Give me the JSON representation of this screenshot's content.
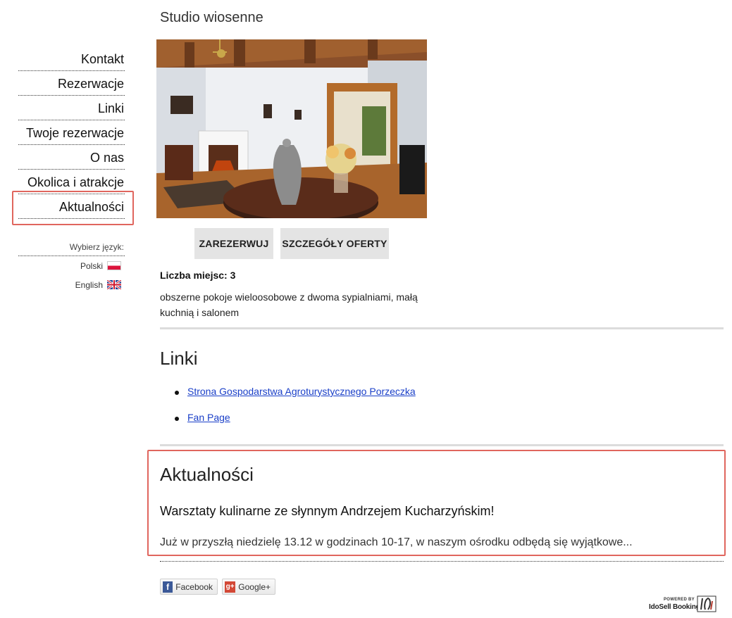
{
  "sidebar": {
    "items": [
      {
        "label": "Kontakt"
      },
      {
        "label": "Rezerwacje"
      },
      {
        "label": "Linki"
      },
      {
        "label": "Twoje rezerwacje"
      },
      {
        "label": "O nas"
      },
      {
        "label": "Okolica i atrakcje"
      },
      {
        "label": "Aktualności"
      }
    ],
    "language": {
      "label": "Wybierz język:",
      "options": [
        {
          "label": "Polski",
          "flag": "poland-flag-icon"
        },
        {
          "label": "English",
          "flag": "uk-flag-icon"
        }
      ]
    }
  },
  "room": {
    "title": "Studio wiosenne",
    "photo_icon": "room-interior-photo",
    "reserve_label": "ZAREZERWUJ",
    "details_label": "SZCZEGÓŁY OFERTY",
    "capacity_label": "Liczba miejsc:",
    "capacity_value": "3",
    "description": "obszerne pokoje wieloosobowe z dwoma sypialniami, małą kuchnią i salonem"
  },
  "links": {
    "title": "Linki",
    "items": [
      {
        "label": "Strona Gospodarstwa Agroturystycznego Porzeczka"
      },
      {
        "label": "Fan Page"
      }
    ]
  },
  "news": {
    "title": "Aktualności",
    "headline": "Warsztaty kulinarne ze słynnym Andrzejem Kucharzyńskim!",
    "excerpt": "Już w przyszłą niedzielę 13.12 w godzinach 10-17, w naszym ośrodku odbędą się wyjątkowe..."
  },
  "social": {
    "facebook_label": "Facebook",
    "googleplus_label": "Google+"
  },
  "footer": {
    "powered_by": "POWERED BY",
    "brand": "IdoSell Booking"
  },
  "colors": {
    "highlight": "#e0665e",
    "link": "#1a3fc8",
    "button_bg": "#e4e4e4"
  }
}
